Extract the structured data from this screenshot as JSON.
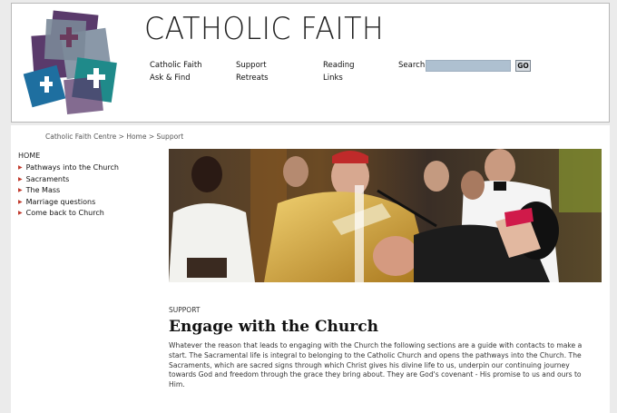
{
  "header": {
    "site_title": "CATHOLIC FAITH",
    "nav_col1": [
      "Catholic Faith",
      "Ask & Find"
    ],
    "nav_col2": [
      "Support",
      "Retreats"
    ],
    "nav_col3": [
      "Reading",
      "Links"
    ],
    "search_label": "Search",
    "search_value": "",
    "search_button": "GO"
  },
  "breadcrumb": {
    "items": [
      "Catholic Faith Centre",
      "Home",
      "Support"
    ],
    "separator": ">"
  },
  "sidebar": {
    "home": "HOME",
    "items": [
      {
        "label": "Pathways into the Church"
      },
      {
        "label": "Sacraments"
      },
      {
        "label": "The Mass"
      },
      {
        "label": "Marriage questions"
      },
      {
        "label": "Come back to Church"
      }
    ],
    "arrow_icon": "triangle-right-icon",
    "arrow_color": "#c0392b"
  },
  "main": {
    "section_label": "SUPPORT",
    "title": "Engage with the Church",
    "body": "Whatever the reason that leads to engaging with the Church the following sections are a guide with contacts to make a start. The Sacramental life is integral to belonging to the Catholic Church and opens the pathways into the Church. The Sacraments, which are sacred signs through which Christ gives his divine life to us, underpin our continuing journey towards God and freedom through the grace they bring about. They are God's covenant - His promise to us and ours to Him."
  },
  "colors": {
    "logo_purple": "#5a3a6b",
    "logo_gray": "#8a98a8",
    "logo_teal": "#1f8a8a",
    "logo_blue": "#1e6fa0",
    "search_field": "#aec0d0"
  }
}
